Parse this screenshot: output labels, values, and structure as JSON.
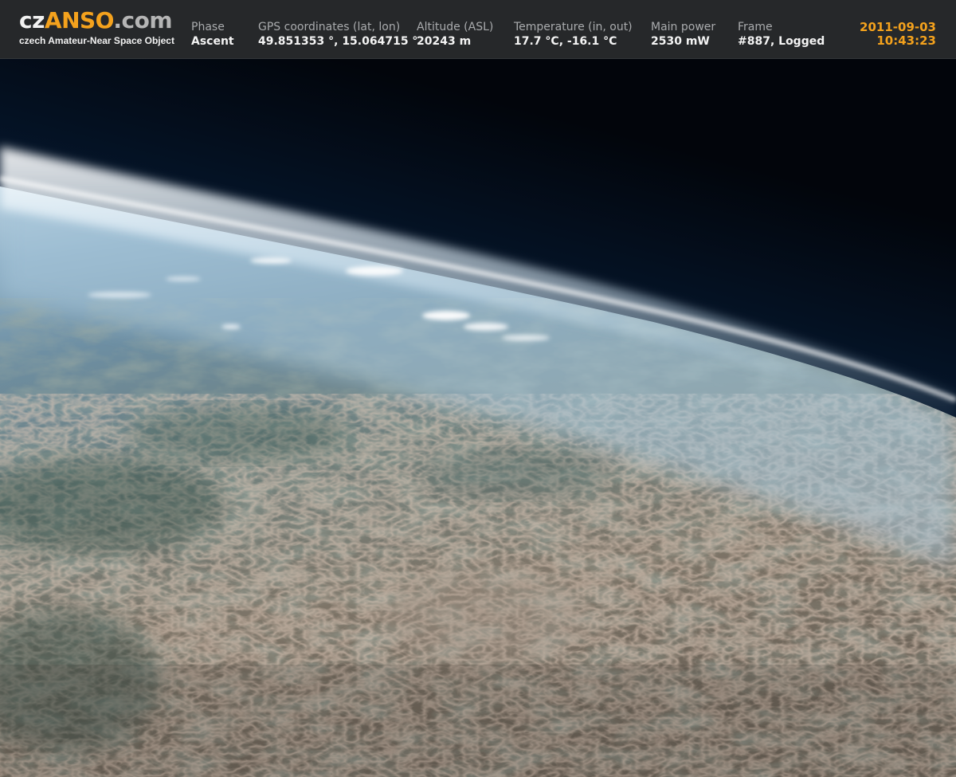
{
  "brand": {
    "logo_prefix": "cz",
    "logo_mid": "ANSO",
    "logo_suffix": ".com",
    "tagline": "czech Amateur-Near Space Object"
  },
  "telemetry": {
    "phase": {
      "label": "Phase",
      "value": "Ascent"
    },
    "gps": {
      "label": "GPS coordinates (lat, lon)",
      "value": "49.851353 °, 15.064715 °"
    },
    "altitude": {
      "label": "Altitude (ASL)",
      "value": "20243 m"
    },
    "temperature": {
      "label": "Temperature (in, out)",
      "value": "17.7 °C, -16.1 °C"
    },
    "power": {
      "label": "Main power",
      "value": "2530 mW"
    },
    "frame": {
      "label": "Frame",
      "value": "#887, Logged"
    }
  },
  "timestamp": {
    "date": "2011-09-03",
    "time": "10:43:23"
  },
  "colors": {
    "header_bg": "#26282a",
    "accent": "#f4a21d",
    "label_gray": "#a9abad",
    "space_dark": "#02050b",
    "horizon_glow": "#e6f2fa",
    "ground_brown": "#8a7563",
    "ground_green": "#3c5a4c"
  }
}
